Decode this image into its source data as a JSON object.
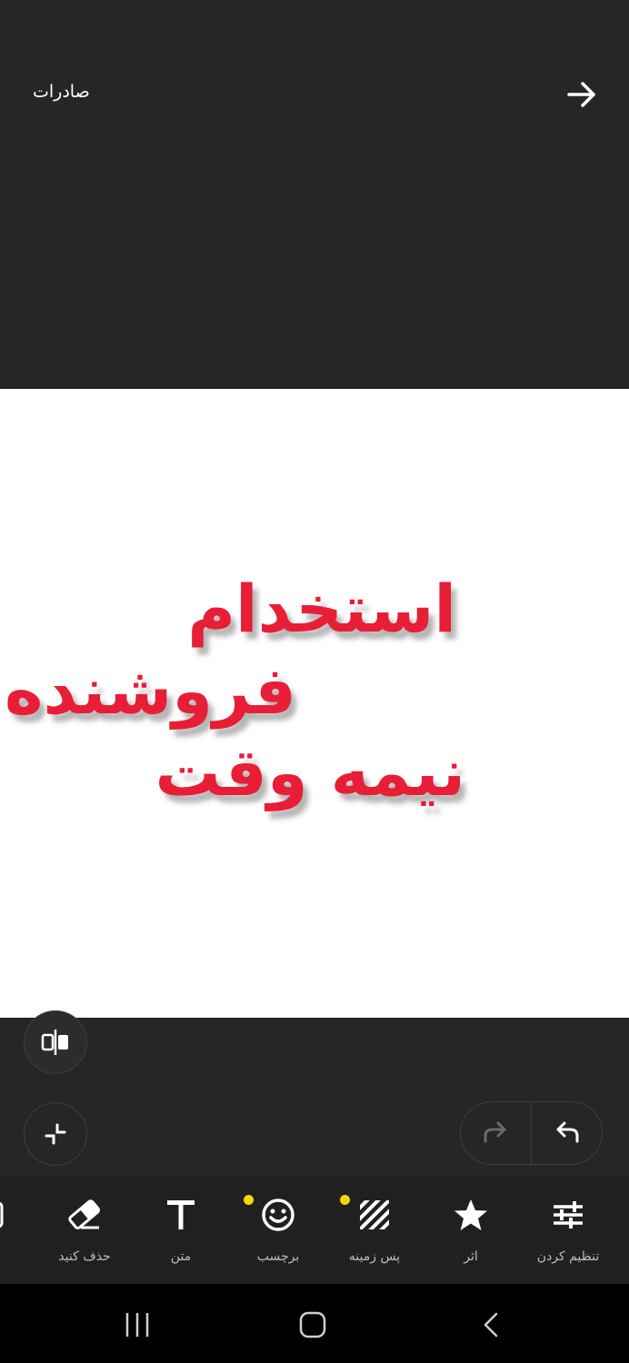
{
  "header": {
    "export_label": "صادرات"
  },
  "canvas": {
    "text_lines": [
      "استخدام",
      "فروشنده",
      "نیمه  وقت"
    ],
    "text_color": "#e81e36"
  },
  "tools": [
    {
      "label": "تنظیم کردن",
      "icon": "sliders-icon"
    },
    {
      "label": "اثر",
      "icon": "star-icon"
    },
    {
      "label": "پس زمینه",
      "icon": "background-pattern-icon",
      "has_dot": true
    },
    {
      "label": "برچسب",
      "icon": "smiley-sticker-icon",
      "has_dot": true
    },
    {
      "label": "متن",
      "icon": "text-t-icon"
    },
    {
      "label": "حذف کنید",
      "icon": "eraser-icon"
    }
  ],
  "colors": {
    "dot": "#f5d800",
    "background": "#262626"
  }
}
